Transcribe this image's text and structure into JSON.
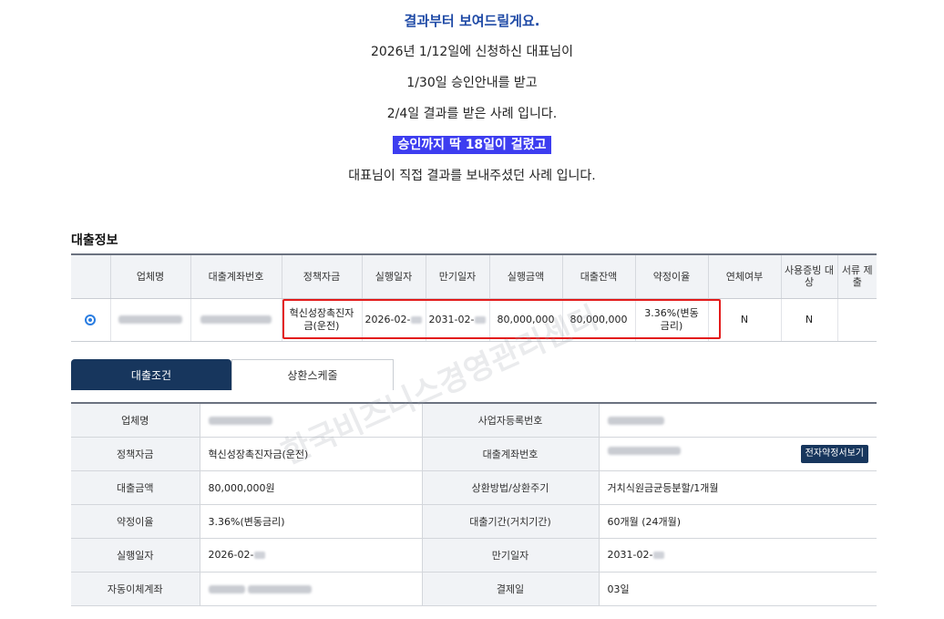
{
  "intro": {
    "title": "결과부터 보여드릴게요.",
    "line1": "2026년 1/12일에 신청하신 대표님이",
    "line2": "1/30일 승인안내를 받고",
    "line3": "2/4일 결과를 받은 사례 입니다.",
    "highlight": "승인까지 딱 18일이 걸렸고",
    "line5": "대표님이 직접 결과를 보내주셨던 사례 입니다."
  },
  "section": {
    "title": "대출정보"
  },
  "loan_table": {
    "headers": [
      "",
      "업체명",
      "대출계좌번호",
      "정책자금",
      "실행일자",
      "만기일자",
      "실행금액",
      "대출잔액",
      "약정이율",
      "연체여부",
      "사용증빙 대상",
      "서류 제출"
    ],
    "row": {
      "policy_fund": "혁신성장촉진자금(운전)",
      "exec_date": "2026-02-",
      "maturity_date": "2031-02-",
      "exec_amount": "80,000,000",
      "balance": "80,000,000",
      "rate": "3.36%(변동금리)",
      "overdue": "N",
      "evidence": "N"
    }
  },
  "tabs": [
    {
      "label": "대출조건",
      "active": true
    },
    {
      "label": "상환스케줄",
      "active": false
    }
  ],
  "detail": {
    "company_label": "업체명",
    "bizno_label": "사업자등록번호",
    "policy_label": "정책자금",
    "policy_value": "혁신성장촉진자금(운전)",
    "account_label": "대출계좌번호",
    "agreement_button": "전자약정서보기",
    "amount_label": "대출금액",
    "amount_value": "80,000,000원",
    "repay_label": "상환방법/상환주기",
    "repay_value": "거치식원금균등분할/1개월",
    "rate_label": "약정이율",
    "rate_value": "3.36%(변동금리)",
    "period_label": "대출기간(거치기간)",
    "period_value": "60개월 (24개월)",
    "exec_label": "실행일자",
    "exec_value": "2026-02-",
    "maturity_label": "만기일자",
    "maturity_value": "2031-02-",
    "autopay_label": "자동이체계좌",
    "payday_label": "결제일",
    "payday_value": "03일"
  },
  "watermark": "한국비즈니스경영관리센터",
  "colors": {
    "title_blue": "#1f4aa6",
    "highlight_bg": "#3d3df0",
    "navy": "#17365d",
    "red_box": "#e31b1b",
    "radio_blue": "#2a7de1"
  }
}
